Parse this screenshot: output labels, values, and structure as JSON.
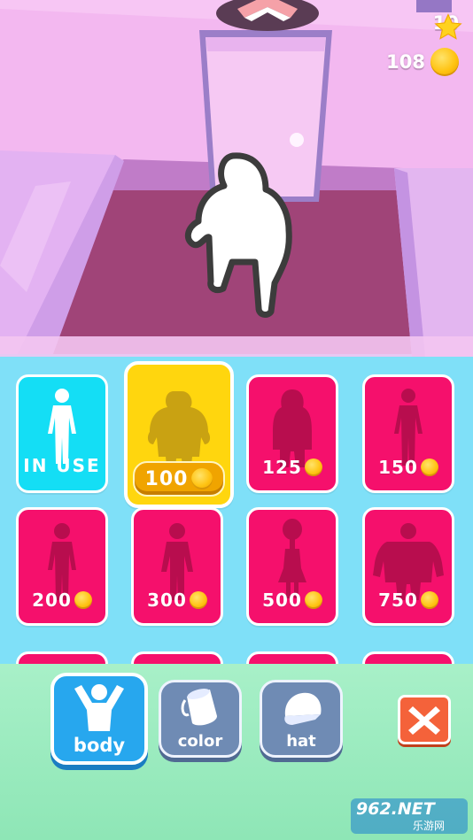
{
  "hud": {
    "stars": "10",
    "coins": "108",
    "star_icon": "star-icon",
    "coin_icon": "coin-icon"
  },
  "shop": {
    "rows": [
      [
        {
          "state": "in-use",
          "label": "IN USE",
          "price": null,
          "color": "#14def5"
        },
        {
          "state": "selected",
          "label": null,
          "price": "100",
          "color": "#ffd60e"
        },
        {
          "state": "locked",
          "label": null,
          "price": "125",
          "color": "#f5106c"
        },
        {
          "state": "locked",
          "label": null,
          "price": "150",
          "color": "#f5106c"
        }
      ],
      [
        {
          "state": "locked",
          "price": "200",
          "color": "#f5106c"
        },
        {
          "state": "locked",
          "price": "300",
          "color": "#f5106c"
        },
        {
          "state": "locked",
          "price": "500",
          "color": "#f5106c"
        },
        {
          "state": "locked",
          "price": "750",
          "color": "#f5106c"
        }
      ]
    ]
  },
  "tabs": {
    "body": "body",
    "color": "color",
    "hat": "hat",
    "active": "body"
  },
  "close_icon": "close-x-icon",
  "watermark": {
    "brand": "962.NET",
    "sub": "乐游网"
  }
}
